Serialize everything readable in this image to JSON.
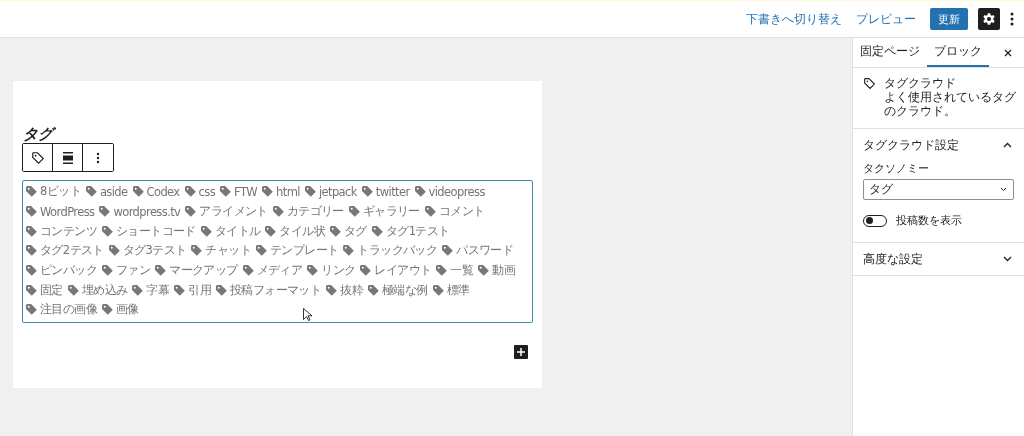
{
  "topbar": {
    "draft_link": "下書きへ切り替え",
    "preview": "プレビュー",
    "update": "更新",
    "settings_active": true
  },
  "block": {
    "heading": "タグ",
    "tags": [
      "8ビット",
      "aside",
      "Codex",
      "css",
      "FTW",
      "html",
      "jetpack",
      "twitter",
      "videopress",
      "WordPress",
      "wordpress.tv",
      "アライメント",
      "カテゴリー",
      "ギャラリー",
      "コメント",
      "コンテンツ",
      "ショートコード",
      "タイトル",
      "タイル状",
      "タグ",
      "タグ1テスト",
      "タグ2テスト",
      "タグ3テスト",
      "チャット",
      "テンプレート",
      "トラックバック",
      "パスワード",
      "ピンバック",
      "ファン",
      "マークアップ",
      "メディア",
      "リンク",
      "レイアウト",
      "一覧",
      "動画",
      "固定",
      "埋め込み",
      "字幕",
      "引用",
      "投稿フォーマット",
      "抜粋",
      "極端な例",
      "標準",
      "注目の画像",
      "画像"
    ]
  },
  "sidebar": {
    "tabs": [
      {
        "label": "固定ページ",
        "selected": false
      },
      {
        "label": "ブロック",
        "selected": true
      }
    ],
    "block_card": {
      "title": "タグクラウド",
      "description": "よく使用されているタグのクラウド。"
    },
    "panels": [
      {
        "title": "タグクラウド設定",
        "expanded": true,
        "taxonomy_label": "タクソノミー",
        "taxonomy_value": "タグ",
        "toggle_label": "投稿数を表示",
        "toggle_on": false
      },
      {
        "title": "高度な設定",
        "expanded": false
      }
    ]
  }
}
